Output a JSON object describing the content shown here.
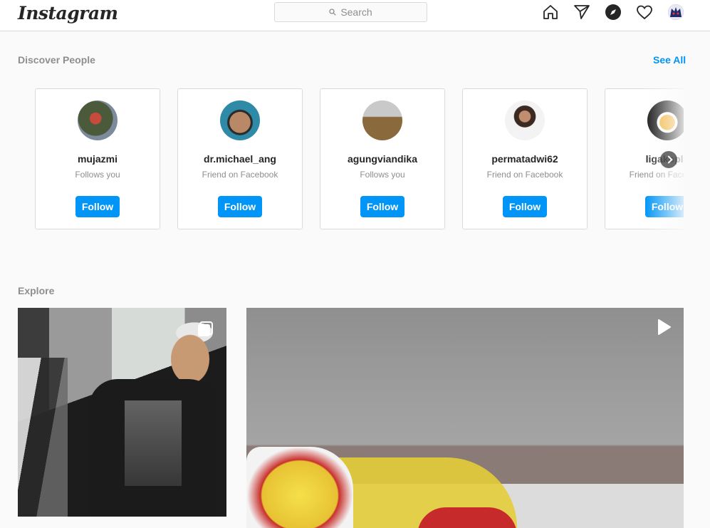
{
  "header": {
    "logo": "Instagram",
    "search_placeholder": "Search"
  },
  "discover": {
    "title": "Discover People",
    "see_all": "See All",
    "button_label": "Follow",
    "people": [
      {
        "username": "mujazmi",
        "subtitle": "Follows you"
      },
      {
        "username": "dr.michael_ang",
        "subtitle": "Friend on Facebook"
      },
      {
        "username": "agungviandika",
        "subtitle": "Follows you"
      },
      {
        "username": "permatadwi62",
        "subtitle": "Friend on Facebook"
      },
      {
        "username": "ligakopla",
        "subtitle": "Friend on Facebook"
      }
    ]
  },
  "explore": {
    "title": "Explore"
  },
  "colors": {
    "accent": "#0095f6",
    "muted_text": "#8e8e8e",
    "border": "#dbdbdb",
    "background": "#fafafa"
  },
  "icons": [
    "search-icon",
    "home-icon",
    "direct-icon",
    "explore-icon",
    "heart-icon",
    "carousel-icon",
    "video-icon",
    "chevron-right-icon"
  ]
}
